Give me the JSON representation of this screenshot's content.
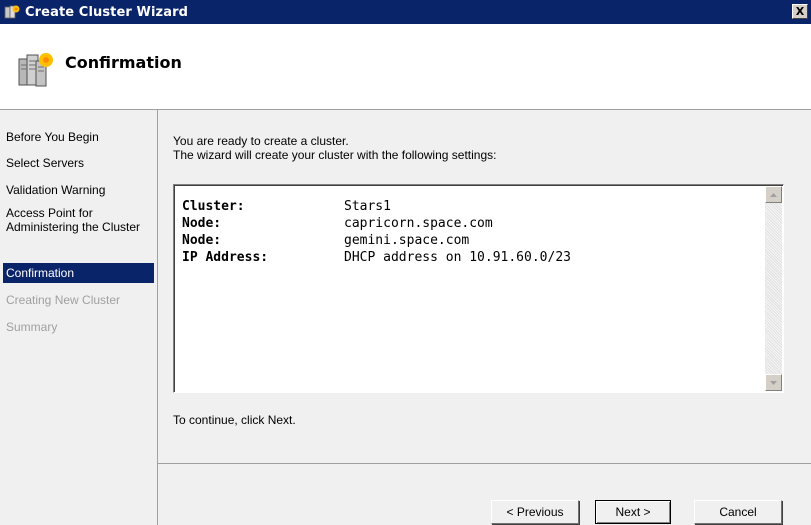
{
  "window": {
    "title": "Create Cluster Wizard",
    "close_label": "X"
  },
  "header": {
    "title": "Confirmation"
  },
  "nav": {
    "items": [
      {
        "label": "Before You Begin",
        "state": "normal"
      },
      {
        "label": "Select Servers",
        "state": "normal"
      },
      {
        "label": "Validation Warning",
        "state": "normal"
      },
      {
        "label": "Access Point for Administering the Cluster",
        "state": "normal"
      },
      {
        "label": "Confirmation",
        "state": "active"
      },
      {
        "label": "Creating New Cluster",
        "state": "disabled"
      },
      {
        "label": "Summary",
        "state": "disabled"
      }
    ]
  },
  "content": {
    "intro_line1": "You are ready to create a cluster.",
    "intro_line2": "The wizard will create your cluster with the following settings:",
    "settings": [
      {
        "key": "Cluster:",
        "value": "Stars1"
      },
      {
        "key": "Node:",
        "value": "capricorn.space.com"
      },
      {
        "key": "Node:",
        "value": "gemini.space.com"
      },
      {
        "key": "IP Address:",
        "value": "DHCP address on 10.91.60.0/23"
      }
    ],
    "continue_text": "To continue, click Next."
  },
  "buttons": {
    "previous": "< Previous",
    "next": "Next >",
    "cancel": "Cancel"
  },
  "colors": {
    "titlebar": "#0a246a",
    "active_nav": "#0a246a",
    "disabled_text": "#a0a0a0"
  }
}
